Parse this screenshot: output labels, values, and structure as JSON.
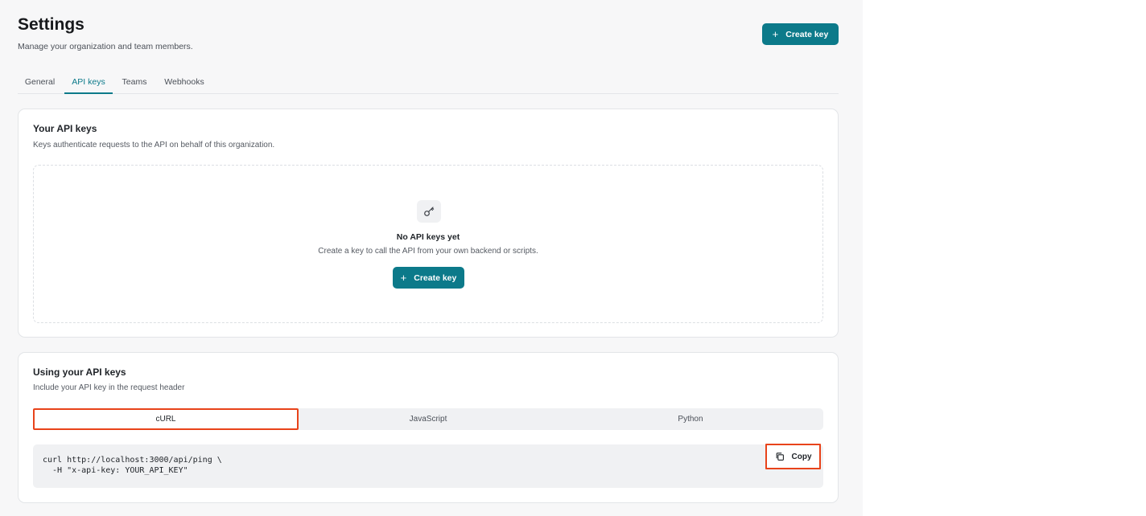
{
  "header": {
    "title": "Settings",
    "subtitle": "Manage your organization and team members.",
    "create_button": {
      "icon": "plus-icon",
      "label": "Create key"
    }
  },
  "tabs": [
    {
      "label": "General",
      "active": false
    },
    {
      "label": "API keys",
      "active": true
    },
    {
      "label": "Teams",
      "active": false
    },
    {
      "label": "Webhooks",
      "active": false
    }
  ],
  "api_keys_card": {
    "title": "Your API keys",
    "description": "Keys authenticate requests to the API on behalf of this organization.",
    "empty_state": {
      "icon": "key-icon",
      "title": "No API keys yet",
      "description": "Create a key to call the API from your own backend or scripts.",
      "button_label": "Create key"
    }
  },
  "usage_card": {
    "title": "Using your API keys",
    "description": "Include your API key in the request header",
    "languages": [
      {
        "label": "cURL",
        "active": true
      },
      {
        "label": "JavaScript",
        "active": false
      },
      {
        "label": "Python",
        "active": false
      }
    ],
    "code": "curl http://localhost:3000/api/ping \\\n  -H \"x-api-key: YOUR_API_KEY\"",
    "copy_label": "Copy"
  },
  "colors": {
    "accent": "#0c7a8a",
    "highlight": "#e8431a",
    "page_background": "#f7f7f8"
  }
}
